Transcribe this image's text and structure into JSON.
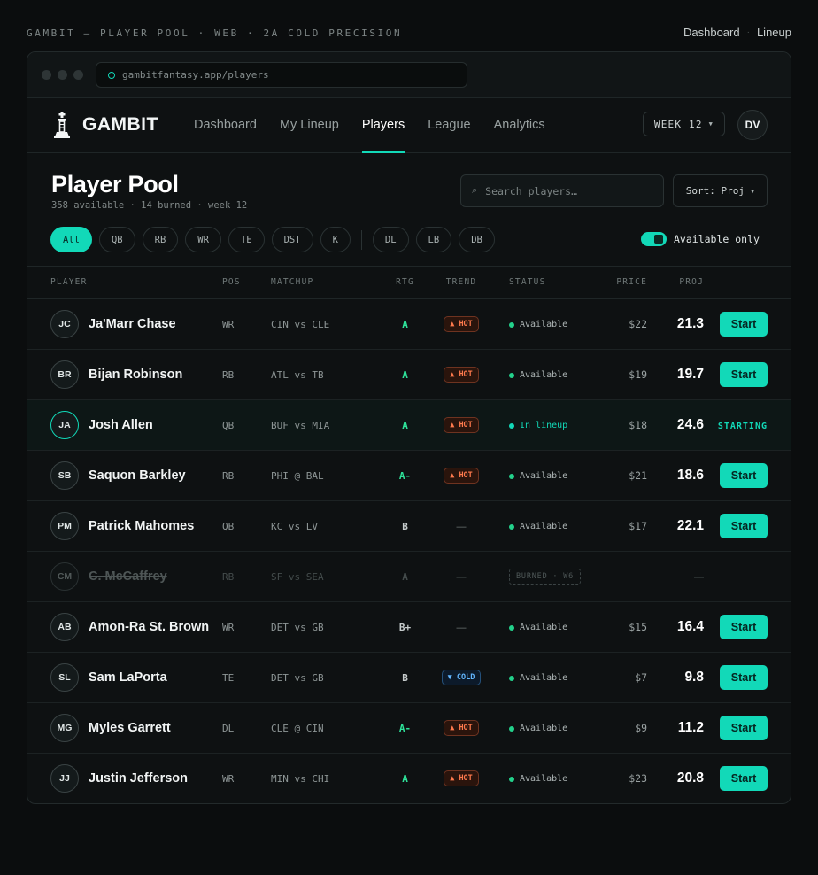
{
  "caption": "GAMBIT — PLAYER POOL · WEB · 2A COLD PRECISION",
  "top_links": [
    "Dashboard",
    "Lineup"
  ],
  "top_sep": "·",
  "browser": {
    "url": "gambitfantasy.app/players"
  },
  "nav": {
    "brand": "GAMBIT",
    "links": [
      "Dashboard",
      "My Lineup",
      "Players",
      "League",
      "Analytics"
    ],
    "active": "Players",
    "week": "WEEK 12",
    "avatar": "DV"
  },
  "header": {
    "title": "Player Pool",
    "subtitle": "358 available · 14 burned · week 12",
    "search_placeholder": "Search players…",
    "sort_label": "Sort: Proj"
  },
  "filters": {
    "primary": [
      "All",
      "QB",
      "RB",
      "WR",
      "TE",
      "DST",
      "K"
    ],
    "secondary": [
      "DL",
      "LB",
      "DB"
    ],
    "active": "All",
    "available_only_label": "Available only",
    "available_only": true
  },
  "table": {
    "columns": [
      "PLAYER",
      "POS",
      "MATCHUP",
      "RTG",
      "TREND",
      "STATUS",
      "PRICE",
      "PROJ"
    ],
    "rows": [
      {
        "initials": "JC",
        "name": "Ja'Marr Chase",
        "pos": "WR",
        "matchup": "CIN vs CLE",
        "rtg": "A",
        "trend": "▲ HOT",
        "trend_type": "hot",
        "status": "Available",
        "state": "available",
        "price": "$22",
        "proj": "21.3",
        "action": "Start"
      },
      {
        "initials": "BR",
        "name": "Bijan Robinson",
        "pos": "RB",
        "matchup": "ATL vs TB",
        "rtg": "A",
        "trend": "▲ HOT",
        "trend_type": "hot",
        "status": "Available",
        "state": "available",
        "price": "$19",
        "proj": "19.7",
        "action": "Start"
      },
      {
        "initials": "JA",
        "name": "Josh Allen",
        "pos": "QB",
        "matchup": "BUF vs MIA",
        "rtg": "A",
        "trend": "▲ HOT",
        "trend_type": "hot",
        "status": "In lineup",
        "state": "inlineup",
        "price": "$18",
        "proj": "24.6",
        "action": "STARTING"
      },
      {
        "initials": "SB",
        "name": "Saquon Barkley",
        "pos": "RB",
        "matchup": "PHI @ BAL",
        "rtg": "A-",
        "trend": "▲ HOT",
        "trend_type": "hot",
        "status": "Available",
        "state": "available",
        "price": "$21",
        "proj": "18.6",
        "action": "Start"
      },
      {
        "initials": "PM",
        "name": "Patrick Mahomes",
        "pos": "QB",
        "matchup": "KC vs LV",
        "rtg": "B",
        "trend": "—",
        "trend_type": "none",
        "status": "Available",
        "state": "available",
        "price": "$17",
        "proj": "22.1",
        "action": "Start"
      },
      {
        "initials": "CM",
        "name": "C. McCaffrey",
        "pos": "RB",
        "matchup": "SF vs SEA",
        "rtg": "A",
        "trend": "—",
        "trend_type": "none",
        "status": "BURNED · W6",
        "state": "burned",
        "price": "—",
        "proj": "—",
        "action": ""
      },
      {
        "initials": "AB",
        "name": "Amon-Ra St. Brown",
        "pos": "WR",
        "matchup": "DET vs GB",
        "rtg": "B+",
        "trend": "—",
        "trend_type": "none",
        "status": "Available",
        "state": "available",
        "price": "$15",
        "proj": "16.4",
        "action": "Start"
      },
      {
        "initials": "SL",
        "name": "Sam LaPorta",
        "pos": "TE",
        "matchup": "DET vs GB",
        "rtg": "B",
        "trend": "▼ COLD",
        "trend_type": "cold",
        "status": "Available",
        "state": "available",
        "price": "$7",
        "proj": "9.8",
        "action": "Start"
      },
      {
        "initials": "MG",
        "name": "Myles Garrett",
        "pos": "DL",
        "matchup": "CLE @ CIN",
        "rtg": "A-",
        "trend": "▲ HOT",
        "trend_type": "hot",
        "status": "Available",
        "state": "available",
        "price": "$9",
        "proj": "11.2",
        "action": "Start"
      },
      {
        "initials": "JJ",
        "name": "Justin Jefferson",
        "pos": "WR",
        "matchup": "MIN vs CHI",
        "rtg": "A",
        "trend": "▲ HOT",
        "trend_type": "hot",
        "status": "Available",
        "state": "available",
        "price": "$23",
        "proj": "20.8",
        "action": "Start"
      }
    ]
  },
  "colors": {
    "accent": "#12d9b8",
    "hot": "#ff7a4d",
    "cold": "#62b6ff",
    "available": "#23d18b",
    "rating_green": "#2ee39a",
    "rating_neutral": "#c6cccc"
  },
  "icons": [
    "chess-king-icon",
    "search-icon",
    "chevron-down-icon",
    "secure-ring-icon"
  ]
}
